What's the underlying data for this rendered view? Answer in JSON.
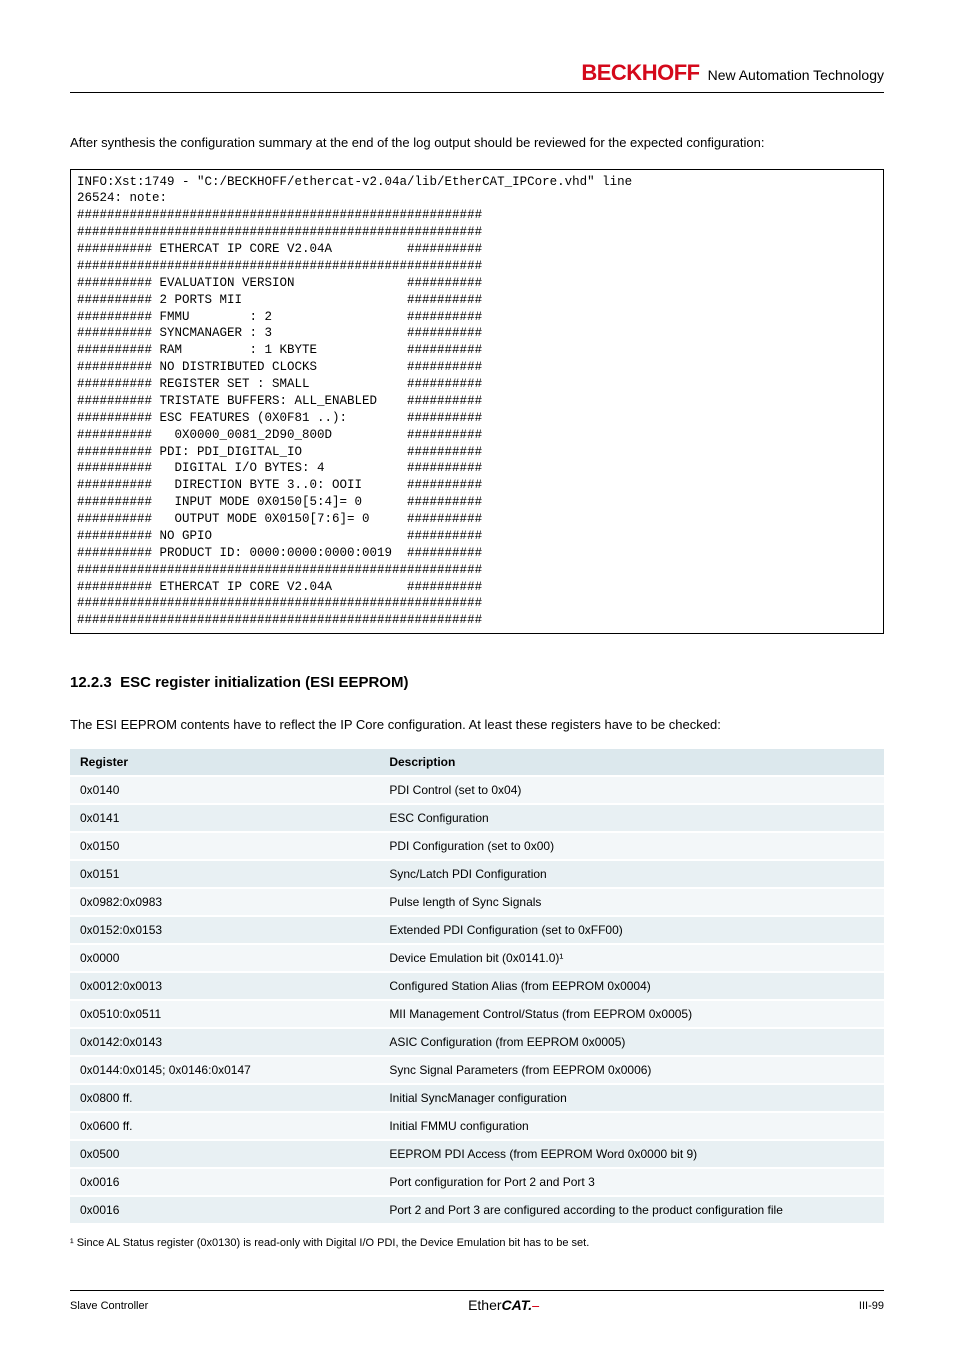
{
  "header": {
    "brand": "BECKHOFF",
    "tagline": "New Automation Technology"
  },
  "intro": "After synthesis the configuration summary at the end of the log output should be reviewed for the expected configuration:",
  "code_lines": [
    "INFO:Xst:1749 - \"C:/BECKHOFF/ethercat-v2.04a/lib/EtherCAT_IPCore.vhd\" line ",
    "26524: note:",
    "######################################################",
    "######################################################",
    "########## ETHERCAT IP CORE V2.04A          ##########",
    "######################################################",
    "########## EVALUATION VERSION               ##########",
    "########## 2 PORTS MII                      ##########",
    "########## FMMU        : 2                  ##########",
    "########## SYNCMANAGER : 3                  ##########",
    "########## RAM         : 1 KBYTE            ##########",
    "########## NO DISTRIBUTED CLOCKS            ##########",
    "########## REGISTER SET : SMALL             ##########",
    "########## TRISTATE BUFFERS: ALL_ENABLED    ##########",
    "########## ESC FEATURES (0X0F81 ..):        ##########",
    "##########   0X0000_0081_2D90_800D          ##########",
    "########## PDI: PDI_DIGITAL_IO              ##########",
    "##########   DIGITAL I/O BYTES: 4           ##########",
    "##########   DIRECTION BYTE 3..0: OOII      ##########",
    "##########   INPUT MODE 0X0150[5:4]= 0      ##########",
    "##########   OUTPUT MODE 0X0150[7:6]= 0     ##########",
    "########## NO GPIO                          ##########",
    "########## PRODUCT ID: 0000:0000:0000:0019  ##########",
    "######################################################",
    "########## ETHERCAT IP CORE V2.04A          ##########",
    "######################################################",
    "######################################################"
  ],
  "section": {
    "number": "12.2.3",
    "title": "ESC register initialization (ESI EEPROM)"
  },
  "section_desc": "The ESI EEPROM contents have to reflect the IP Core configuration. At least these registers have to be checked:",
  "table": {
    "headers": [
      "Register",
      "Description"
    ],
    "rows": [
      [
        "0x0140",
        "PDI Control (set to 0x04)"
      ],
      [
        "0x0141",
        "ESC Configuration"
      ],
      [
        "0x0150",
        "PDI Configuration (set to 0x00)"
      ],
      [
        "0x0151",
        "Sync/Latch PDI Configuration"
      ],
      [
        "0x0982:0x0983",
        "Pulse length of Sync Signals"
      ],
      [
        "0x0152:0x0153",
        "Extended PDI Configuration (set to 0xFF00)"
      ],
      [
        "0x0000",
        "Device Emulation bit (0x0141.0)¹"
      ],
      [
        "0x0012:0x0013",
        "Configured Station Alias (from EEPROM 0x0004)"
      ],
      [
        "0x0510:0x0511",
        "MII Management Control/Status (from EEPROM 0x0005)"
      ],
      [
        "0x0142:0x0143",
        "ASIC Configuration (from EEPROM 0x0005)"
      ],
      [
        "0x0144:0x0145; 0x0146:0x0147",
        "Sync Signal Parameters (from EEPROM 0x0006)"
      ],
      [
        "0x0800 ff.",
        "Initial SyncManager configuration"
      ],
      [
        "0x0600 ff.",
        "Initial FMMU configuration"
      ],
      [
        "0x0500",
        "EEPROM PDI Access (from EEPROM Word 0x0000 bit 9)"
      ],
      [
        "0x0016",
        "Port configuration for Port 2 and Port 3"
      ],
      [
        "0x0016",
        "Port 2 and Port 3 are configured according to the product configuration file"
      ]
    ]
  },
  "footnote": "¹ Since AL Status register (0x0130) is read-only with Digital I/O PDI, the Device Emulation bit has to be set.",
  "footer": {
    "left": "Slave Controller",
    "center_a": "Ether",
    "center_b": "CAT.",
    "right": "III-99"
  }
}
